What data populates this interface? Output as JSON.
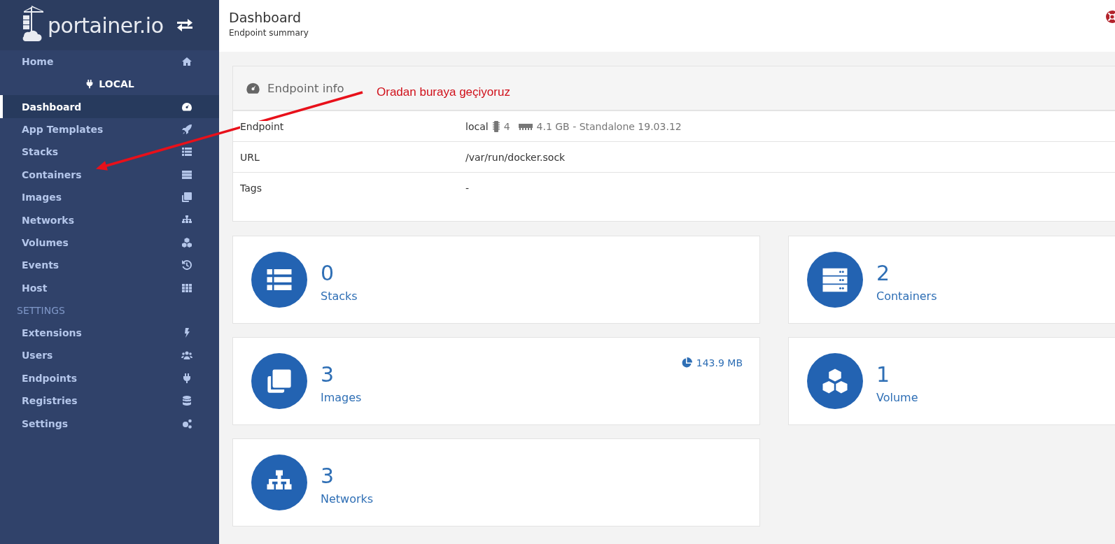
{
  "sidebar": {
    "logo": "portainer.io",
    "items": [
      {
        "label": "Home",
        "selected": false
      }
    ],
    "endpoint_heading": "LOCAL",
    "endpoint_items": [
      {
        "label": "Dashboard",
        "selected": true
      },
      {
        "label": "App Templates",
        "selected": false
      },
      {
        "label": "Stacks",
        "selected": false
      },
      {
        "label": "Containers",
        "selected": false
      },
      {
        "label": "Images",
        "selected": false
      },
      {
        "label": "Networks",
        "selected": false
      },
      {
        "label": "Volumes",
        "selected": false
      },
      {
        "label": "Events",
        "selected": false
      },
      {
        "label": "Host",
        "selected": false
      }
    ],
    "settings_heading": "SETTINGS",
    "settings_items": [
      {
        "label": "Extensions",
        "selected": false
      },
      {
        "label": "Users",
        "selected": false
      },
      {
        "label": "Endpoints",
        "selected": false
      },
      {
        "label": "Registries",
        "selected": false
      },
      {
        "label": "Settings",
        "selected": false
      }
    ]
  },
  "header": {
    "title": "Dashboard",
    "subtitle": "Endpoint summary"
  },
  "endpoint_info": {
    "title": "Endpoint info",
    "rows": [
      {
        "label": "Endpoint",
        "value": "local",
        "cpu": "4",
        "memory": "4.1 GB - Standalone 19.03.12"
      },
      {
        "label": "URL",
        "value": "/var/run/docker.sock"
      },
      {
        "label": "Tags",
        "value": "-"
      }
    ]
  },
  "cards": [
    {
      "count": "0",
      "label": "Stacks"
    },
    {
      "count": "2",
      "label": "Containers"
    },
    {
      "count": "3",
      "label": "Images",
      "size": "143.9 MB"
    },
    {
      "count": "1",
      "label": "Volume"
    },
    {
      "count": "3",
      "label": "Networks"
    }
  ],
  "annotation": {
    "text": "Oradan buraya geçiyoruz"
  }
}
